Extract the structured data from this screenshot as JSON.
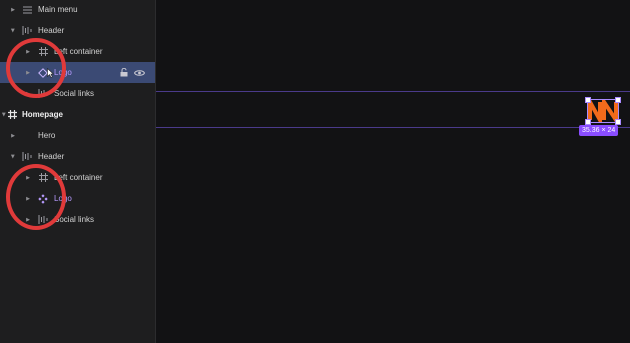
{
  "colors": {
    "panel_bg": "#1e1e1f",
    "canvas_bg": "#121214",
    "selection": "#3b4a74",
    "component_purple": "#b89bff",
    "accent": "#8a4dff",
    "annotation": "#e03a3a",
    "logo_orange": "#f26a1b"
  },
  "layers": [
    {
      "label": "Main menu",
      "icon": "menu-lines-icon"
    },
    {
      "label": "Header",
      "icon": "columns-icon"
    },
    {
      "label": "Left container",
      "icon": "frame-icon"
    },
    {
      "label": "Logo",
      "icon": "component-instance-icon"
    },
    {
      "label": "Social links",
      "icon": "columns-icon"
    },
    {
      "label": "Homepage",
      "icon": "frame-icon"
    },
    {
      "label": "Hero",
      "icon": "none"
    },
    {
      "label": "Header",
      "icon": "columns-icon"
    },
    {
      "label": "Left container",
      "icon": "frame-icon"
    },
    {
      "label": "Logo",
      "icon": "main-component-icon"
    },
    {
      "label": "Social links",
      "icon": "columns-icon"
    }
  ],
  "selected_row_actions": [
    "lock-open-icon",
    "eye-icon"
  ],
  "canvas": {
    "size_label": "35.36 × 24"
  }
}
